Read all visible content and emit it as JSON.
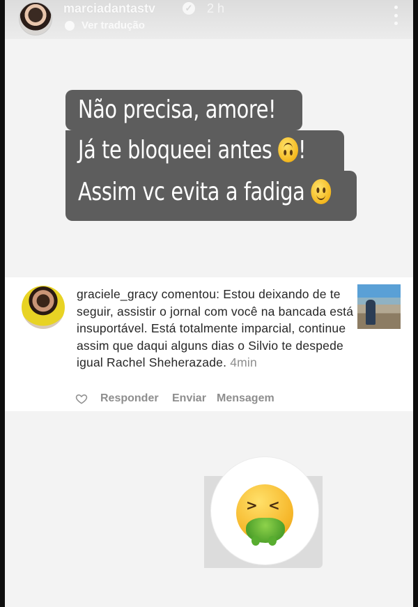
{
  "header": {
    "username": "marciadantastv",
    "time": "2 h",
    "translate_label": "Ver tradução"
  },
  "caption": {
    "line1": "Não precisa, amore!",
    "line2": "Já te bloqueei antes",
    "line2_end": "!",
    "line3": "Assim vc evita a fadiga"
  },
  "comment": {
    "username": "graciele_gracy",
    "body": " comentou: Estou deixando de te seguir, assistir o jornal com você na bancada está insuportável. Está totalmente imparcial, continue assim que daqui alguns dias o Silvio te despede igual Rachel Sheherazade.",
    "time": "4min",
    "actions": {
      "reply": "Responder",
      "send": "Enviar",
      "message": "Mensagem"
    }
  },
  "colors": {
    "bubble": "#5d5d5d",
    "card": "#ffffff",
    "muted": "#8e8e8e"
  },
  "icons": [
    "verified-icon",
    "more-icon",
    "translate-icon",
    "heart-icon",
    "upside-down-face-emoji",
    "smiling-face-emoji",
    "vomiting-face-emoji"
  ]
}
